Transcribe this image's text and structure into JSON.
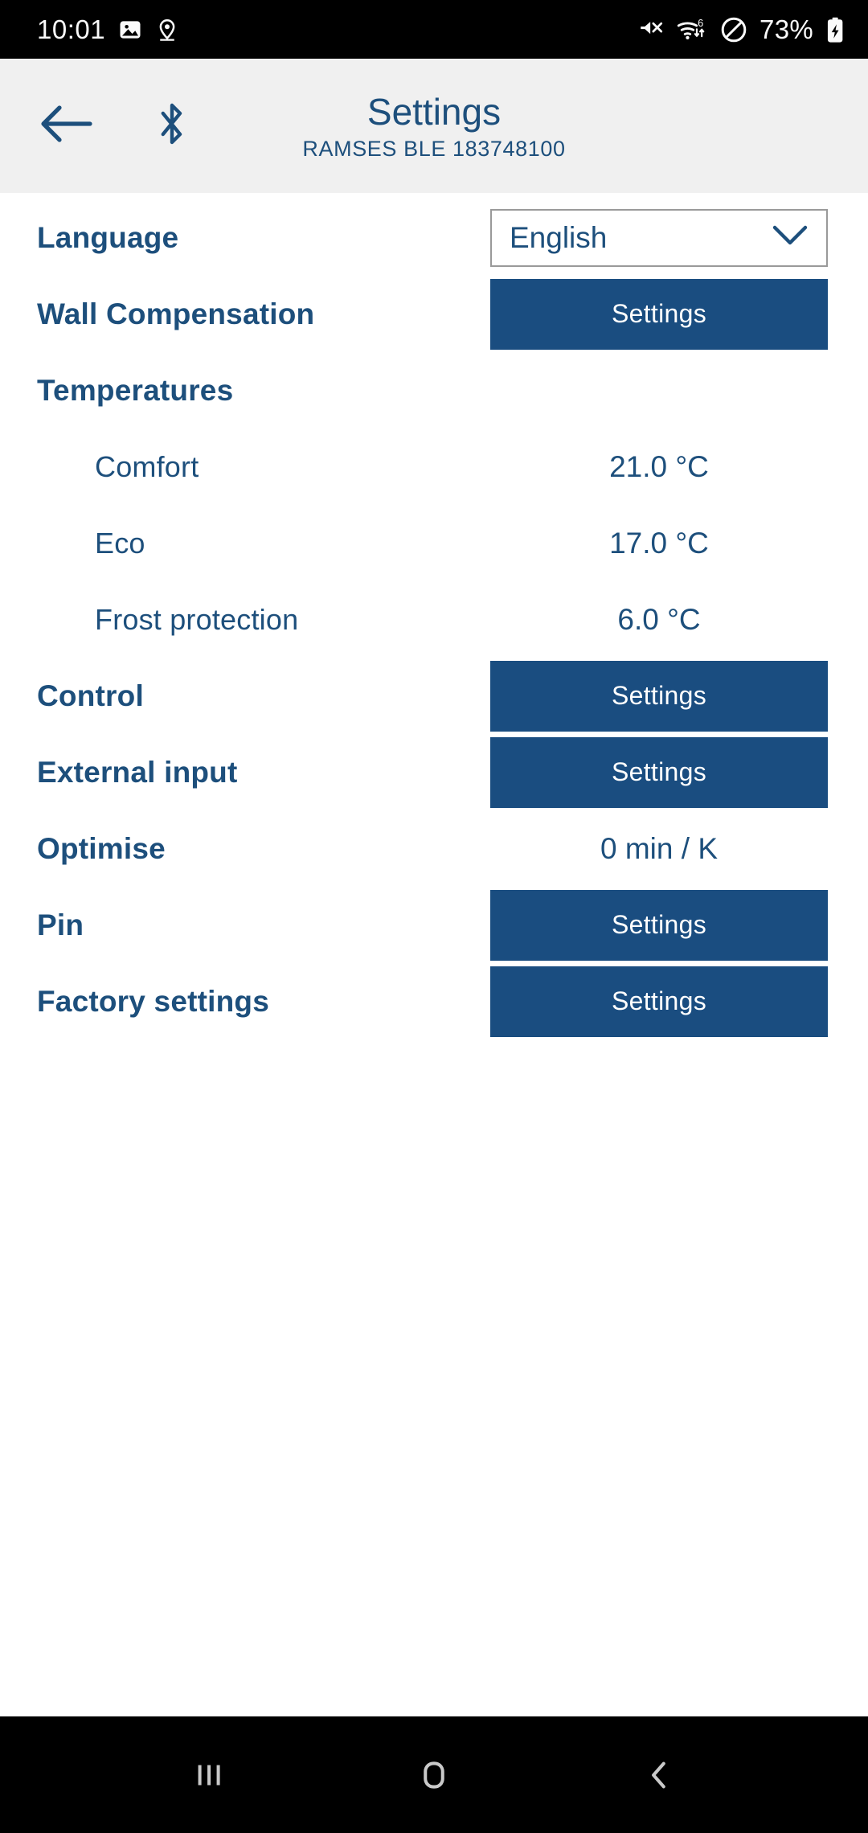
{
  "statusbar": {
    "time": "10:01",
    "battery_percent": "73%",
    "left_icons": [
      "image-icon",
      "location-pin-icon"
    ],
    "right_icons": [
      "mute-icon",
      "wifi-6-icon",
      "do-not-disturb-icon",
      "battery-charging-icon"
    ]
  },
  "header": {
    "title": "Settings",
    "subtitle": "RAMSES BLE 183748100",
    "back_icon": "back-arrow-icon",
    "bluetooth_icon": "bluetooth-icon"
  },
  "colors": {
    "accent_blue": "#1d4f7c",
    "button_blue": "#1a4d80",
    "header_bg": "#f0f0f0",
    "statusbar_bg": "#000000"
  },
  "settings": {
    "language": {
      "label": "Language",
      "selected": "English",
      "options": [
        "English"
      ]
    },
    "wall_compensation": {
      "label": "Wall Compensation",
      "button": "Settings"
    },
    "temperatures": {
      "label": "Temperatures",
      "items": [
        {
          "label": "Comfort",
          "value": "21.0 °C",
          "edit_icon": "pencil-icon"
        },
        {
          "label": "Eco",
          "value": "17.0 °C",
          "edit_icon": "pencil-icon"
        },
        {
          "label": "Frost protection",
          "value": "6.0 °C",
          "edit_icon": "pencil-icon"
        }
      ]
    },
    "control": {
      "label": "Control",
      "button": "Settings"
    },
    "external_input": {
      "label": "External input",
      "button": "Settings"
    },
    "optimise": {
      "label": "Optimise",
      "value": "0 min / K",
      "edit_icon": "pencil-icon"
    },
    "pin": {
      "label": "Pin",
      "button": "Settings"
    },
    "factory_settings": {
      "label": "Factory settings",
      "button": "Settings"
    }
  },
  "navbar": {
    "recents_icon": "recents-icon",
    "home_icon": "home-icon",
    "back_icon": "back-chevron-icon"
  }
}
